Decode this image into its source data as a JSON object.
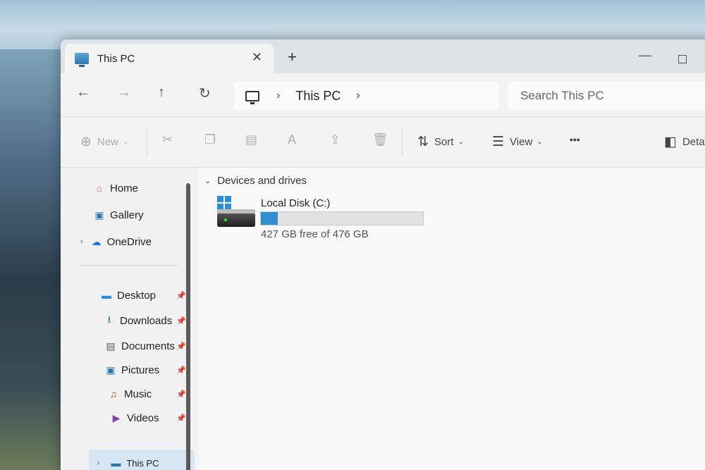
{
  "window": {
    "tab_title": "This PC",
    "tab_close": "✕",
    "new_tab": "+",
    "minimize": "—"
  },
  "nav": {
    "back": "←",
    "forward": "→",
    "up": "↑",
    "refresh": "↻",
    "breadcrumb": [
      "This PC"
    ],
    "search_placeholder": "Search This PC"
  },
  "toolbar": {
    "new_label": "New",
    "sort_label": "Sort",
    "view_label": "View",
    "more_label": "•••",
    "details_label": "Detai"
  },
  "sidebar": {
    "top_items": [
      {
        "label": "Home",
        "icon": "home-icon"
      },
      {
        "label": "Gallery",
        "icon": "gallery-icon"
      },
      {
        "label": "OneDrive",
        "icon": "cloud-icon"
      }
    ],
    "quick_access": [
      {
        "label": "Desktop",
        "icon": "desktop-icon"
      },
      {
        "label": "Downloads",
        "icon": "download-icon"
      },
      {
        "label": "Documents",
        "icon": "document-icon"
      },
      {
        "label": "Pictures",
        "icon": "pictures-icon"
      },
      {
        "label": "Music",
        "icon": "music-icon"
      },
      {
        "label": "Videos",
        "icon": "videos-icon"
      }
    ],
    "this_pc_label": "This PC"
  },
  "main": {
    "group_header": "Devices and drives",
    "drives": [
      {
        "name": "Local Disk (C:)",
        "free_text": "427 GB free of 476 GB",
        "used_fraction": 0.103
      }
    ]
  },
  "colors": {
    "accent": "#2f8fd0",
    "selection": "#d6e6f2"
  }
}
